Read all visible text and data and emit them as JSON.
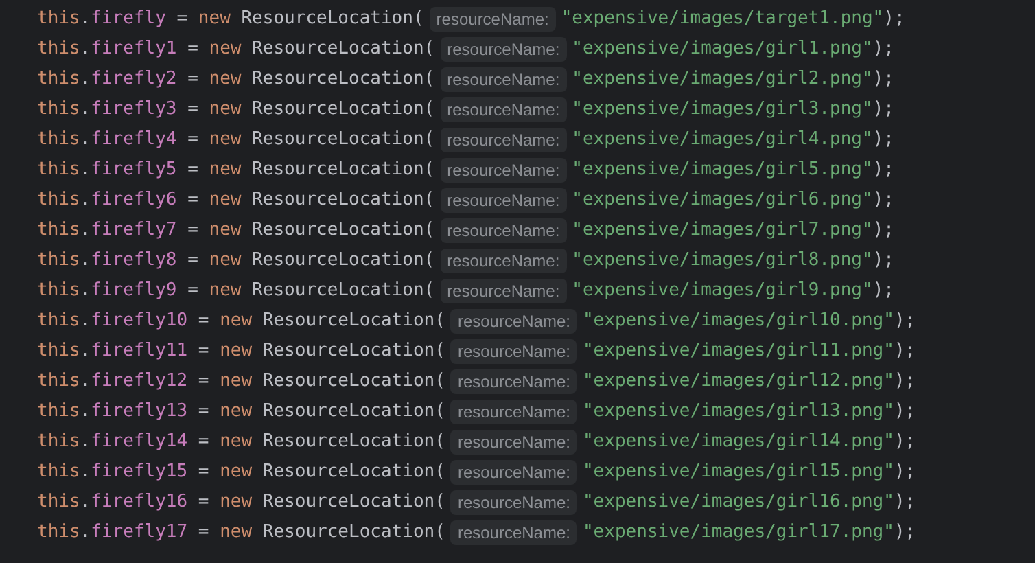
{
  "editor": {
    "lines": [
      {
        "tokens": [
          {
            "kind": "keyword",
            "text": "this"
          },
          {
            "kind": "plain",
            "text": "."
          },
          {
            "kind": "field",
            "text": "firefly"
          },
          {
            "kind": "plain",
            "text": " = "
          },
          {
            "kind": "keyword",
            "text": "new"
          },
          {
            "kind": "plain",
            "text": " ResourceLocation("
          },
          {
            "kind": "hint",
            "text": "resourceName:"
          },
          {
            "kind": "string",
            "text": "\"expensive/images/target1.png\""
          },
          {
            "kind": "plain",
            "text": ");"
          }
        ]
      },
      {
        "tokens": [
          {
            "kind": "keyword",
            "text": "this"
          },
          {
            "kind": "plain",
            "text": "."
          },
          {
            "kind": "field",
            "text": "firefly1"
          },
          {
            "kind": "plain",
            "text": " = "
          },
          {
            "kind": "keyword",
            "text": "new"
          },
          {
            "kind": "plain",
            "text": " ResourceLocation("
          },
          {
            "kind": "hint",
            "text": "resourceName:"
          },
          {
            "kind": "string",
            "text": "\"expensive/images/girl1.png\""
          },
          {
            "kind": "plain",
            "text": ");"
          }
        ]
      },
      {
        "tokens": [
          {
            "kind": "keyword",
            "text": "this"
          },
          {
            "kind": "plain",
            "text": "."
          },
          {
            "kind": "field",
            "text": "firefly2"
          },
          {
            "kind": "plain",
            "text": " = "
          },
          {
            "kind": "keyword",
            "text": "new"
          },
          {
            "kind": "plain",
            "text": " ResourceLocation("
          },
          {
            "kind": "hint",
            "text": "resourceName:"
          },
          {
            "kind": "string",
            "text": "\"expensive/images/girl2.png\""
          },
          {
            "kind": "plain",
            "text": ");"
          }
        ]
      },
      {
        "tokens": [
          {
            "kind": "keyword",
            "text": "this"
          },
          {
            "kind": "plain",
            "text": "."
          },
          {
            "kind": "field",
            "text": "firefly3"
          },
          {
            "kind": "plain",
            "text": " = "
          },
          {
            "kind": "keyword",
            "text": "new"
          },
          {
            "kind": "plain",
            "text": " ResourceLocation("
          },
          {
            "kind": "hint",
            "text": "resourceName:"
          },
          {
            "kind": "string",
            "text": "\"expensive/images/girl3.png\""
          },
          {
            "kind": "plain",
            "text": ");"
          }
        ]
      },
      {
        "tokens": [
          {
            "kind": "keyword",
            "text": "this"
          },
          {
            "kind": "plain",
            "text": "."
          },
          {
            "kind": "field",
            "text": "firefly4"
          },
          {
            "kind": "plain",
            "text": " = "
          },
          {
            "kind": "keyword",
            "text": "new"
          },
          {
            "kind": "plain",
            "text": " ResourceLocation("
          },
          {
            "kind": "hint",
            "text": "resourceName:"
          },
          {
            "kind": "string",
            "text": "\"expensive/images/girl4.png\""
          },
          {
            "kind": "plain",
            "text": ");"
          }
        ]
      },
      {
        "tokens": [
          {
            "kind": "keyword",
            "text": "this"
          },
          {
            "kind": "plain",
            "text": "."
          },
          {
            "kind": "field",
            "text": "firefly5"
          },
          {
            "kind": "plain",
            "text": " = "
          },
          {
            "kind": "keyword",
            "text": "new"
          },
          {
            "kind": "plain",
            "text": " ResourceLocation("
          },
          {
            "kind": "hint",
            "text": "resourceName:"
          },
          {
            "kind": "string",
            "text": "\"expensive/images/girl5.png\""
          },
          {
            "kind": "plain",
            "text": ");"
          }
        ]
      },
      {
        "tokens": [
          {
            "kind": "keyword",
            "text": "this"
          },
          {
            "kind": "plain",
            "text": "."
          },
          {
            "kind": "field",
            "text": "firefly6"
          },
          {
            "kind": "plain",
            "text": " = "
          },
          {
            "kind": "keyword",
            "text": "new"
          },
          {
            "kind": "plain",
            "text": " ResourceLocation("
          },
          {
            "kind": "hint",
            "text": "resourceName:"
          },
          {
            "kind": "string",
            "text": "\"expensive/images/girl6.png\""
          },
          {
            "kind": "plain",
            "text": ");"
          }
        ]
      },
      {
        "tokens": [
          {
            "kind": "keyword",
            "text": "this"
          },
          {
            "kind": "plain",
            "text": "."
          },
          {
            "kind": "field",
            "text": "firefly7"
          },
          {
            "kind": "plain",
            "text": " = "
          },
          {
            "kind": "keyword",
            "text": "new"
          },
          {
            "kind": "plain",
            "text": " ResourceLocation("
          },
          {
            "kind": "hint",
            "text": "resourceName:"
          },
          {
            "kind": "string",
            "text": "\"expensive/images/girl7.png\""
          },
          {
            "kind": "plain",
            "text": ");"
          }
        ]
      },
      {
        "tokens": [
          {
            "kind": "keyword",
            "text": "this"
          },
          {
            "kind": "plain",
            "text": "."
          },
          {
            "kind": "field",
            "text": "firefly8"
          },
          {
            "kind": "plain",
            "text": " = "
          },
          {
            "kind": "keyword",
            "text": "new"
          },
          {
            "kind": "plain",
            "text": " ResourceLocation("
          },
          {
            "kind": "hint",
            "text": "resourceName:"
          },
          {
            "kind": "string",
            "text": "\"expensive/images/girl8.png\""
          },
          {
            "kind": "plain",
            "text": ");"
          }
        ]
      },
      {
        "tokens": [
          {
            "kind": "keyword",
            "text": "this"
          },
          {
            "kind": "plain",
            "text": "."
          },
          {
            "kind": "field",
            "text": "firefly9"
          },
          {
            "kind": "plain",
            "text": " = "
          },
          {
            "kind": "keyword",
            "text": "new"
          },
          {
            "kind": "plain",
            "text": " ResourceLocation("
          },
          {
            "kind": "hint",
            "text": "resourceName:"
          },
          {
            "kind": "string",
            "text": "\"expensive/images/girl9.png\""
          },
          {
            "kind": "plain",
            "text": ");"
          }
        ]
      },
      {
        "tokens": [
          {
            "kind": "keyword",
            "text": "this"
          },
          {
            "kind": "plain",
            "text": "."
          },
          {
            "kind": "field",
            "text": "firefly10"
          },
          {
            "kind": "plain",
            "text": " = "
          },
          {
            "kind": "keyword",
            "text": "new"
          },
          {
            "kind": "plain",
            "text": " ResourceLocation("
          },
          {
            "kind": "hint",
            "text": "resourceName:"
          },
          {
            "kind": "string",
            "text": "\"expensive/images/girl10.png\""
          },
          {
            "kind": "plain",
            "text": ");"
          }
        ]
      },
      {
        "tokens": [
          {
            "kind": "keyword",
            "text": "this"
          },
          {
            "kind": "plain",
            "text": "."
          },
          {
            "kind": "field",
            "text": "firefly11"
          },
          {
            "kind": "plain",
            "text": " = "
          },
          {
            "kind": "keyword",
            "text": "new"
          },
          {
            "kind": "plain",
            "text": " ResourceLocation("
          },
          {
            "kind": "hint",
            "text": "resourceName:"
          },
          {
            "kind": "string",
            "text": "\"expensive/images/girl11.png\""
          },
          {
            "kind": "plain",
            "text": ");"
          }
        ]
      },
      {
        "tokens": [
          {
            "kind": "keyword",
            "text": "this"
          },
          {
            "kind": "plain",
            "text": "."
          },
          {
            "kind": "field",
            "text": "firefly12"
          },
          {
            "kind": "plain",
            "text": " = "
          },
          {
            "kind": "keyword",
            "text": "new"
          },
          {
            "kind": "plain",
            "text": " ResourceLocation("
          },
          {
            "kind": "hint",
            "text": "resourceName:"
          },
          {
            "kind": "string",
            "text": "\"expensive/images/girl12.png\""
          },
          {
            "kind": "plain",
            "text": ");"
          }
        ]
      },
      {
        "tokens": [
          {
            "kind": "keyword",
            "text": "this"
          },
          {
            "kind": "plain",
            "text": "."
          },
          {
            "kind": "field",
            "text": "firefly13"
          },
          {
            "kind": "plain",
            "text": " = "
          },
          {
            "kind": "keyword",
            "text": "new"
          },
          {
            "kind": "plain",
            "text": " ResourceLocation("
          },
          {
            "kind": "hint",
            "text": "resourceName:"
          },
          {
            "kind": "string",
            "text": "\"expensive/images/girl13.png\""
          },
          {
            "kind": "plain",
            "text": ");"
          }
        ]
      },
      {
        "tokens": [
          {
            "kind": "keyword",
            "text": "this"
          },
          {
            "kind": "plain",
            "text": "."
          },
          {
            "kind": "field",
            "text": "firefly14"
          },
          {
            "kind": "plain",
            "text": " = "
          },
          {
            "kind": "keyword",
            "text": "new"
          },
          {
            "kind": "plain",
            "text": " ResourceLocation("
          },
          {
            "kind": "hint",
            "text": "resourceName:"
          },
          {
            "kind": "string",
            "text": "\"expensive/images/girl14.png\""
          },
          {
            "kind": "plain",
            "text": ");"
          }
        ]
      },
      {
        "tokens": [
          {
            "kind": "keyword",
            "text": "this"
          },
          {
            "kind": "plain",
            "text": "."
          },
          {
            "kind": "field",
            "text": "firefly15"
          },
          {
            "kind": "plain",
            "text": " = "
          },
          {
            "kind": "keyword",
            "text": "new"
          },
          {
            "kind": "plain",
            "text": " ResourceLocation("
          },
          {
            "kind": "hint",
            "text": "resourceName:"
          },
          {
            "kind": "string",
            "text": "\"expensive/images/girl15.png\""
          },
          {
            "kind": "plain",
            "text": ");"
          }
        ]
      },
      {
        "tokens": [
          {
            "kind": "keyword",
            "text": "this"
          },
          {
            "kind": "plain",
            "text": "."
          },
          {
            "kind": "field",
            "text": "firefly16"
          },
          {
            "kind": "plain",
            "text": " = "
          },
          {
            "kind": "keyword",
            "text": "new"
          },
          {
            "kind": "plain",
            "text": " ResourceLocation("
          },
          {
            "kind": "hint",
            "text": "resourceName:"
          },
          {
            "kind": "string",
            "text": "\"expensive/images/girl16.png\""
          },
          {
            "kind": "plain",
            "text": ");"
          }
        ]
      },
      {
        "tokens": [
          {
            "kind": "keyword",
            "text": "this"
          },
          {
            "kind": "plain",
            "text": "."
          },
          {
            "kind": "field",
            "text": "firefly17"
          },
          {
            "kind": "plain",
            "text": " = "
          },
          {
            "kind": "keyword",
            "text": "new"
          },
          {
            "kind": "plain",
            "text": " ResourceLocation("
          },
          {
            "kind": "hint",
            "text": "resourceName:"
          },
          {
            "kind": "string",
            "text": "\"expensive/images/girl17.png\""
          },
          {
            "kind": "plain",
            "text": ");"
          }
        ]
      }
    ]
  }
}
